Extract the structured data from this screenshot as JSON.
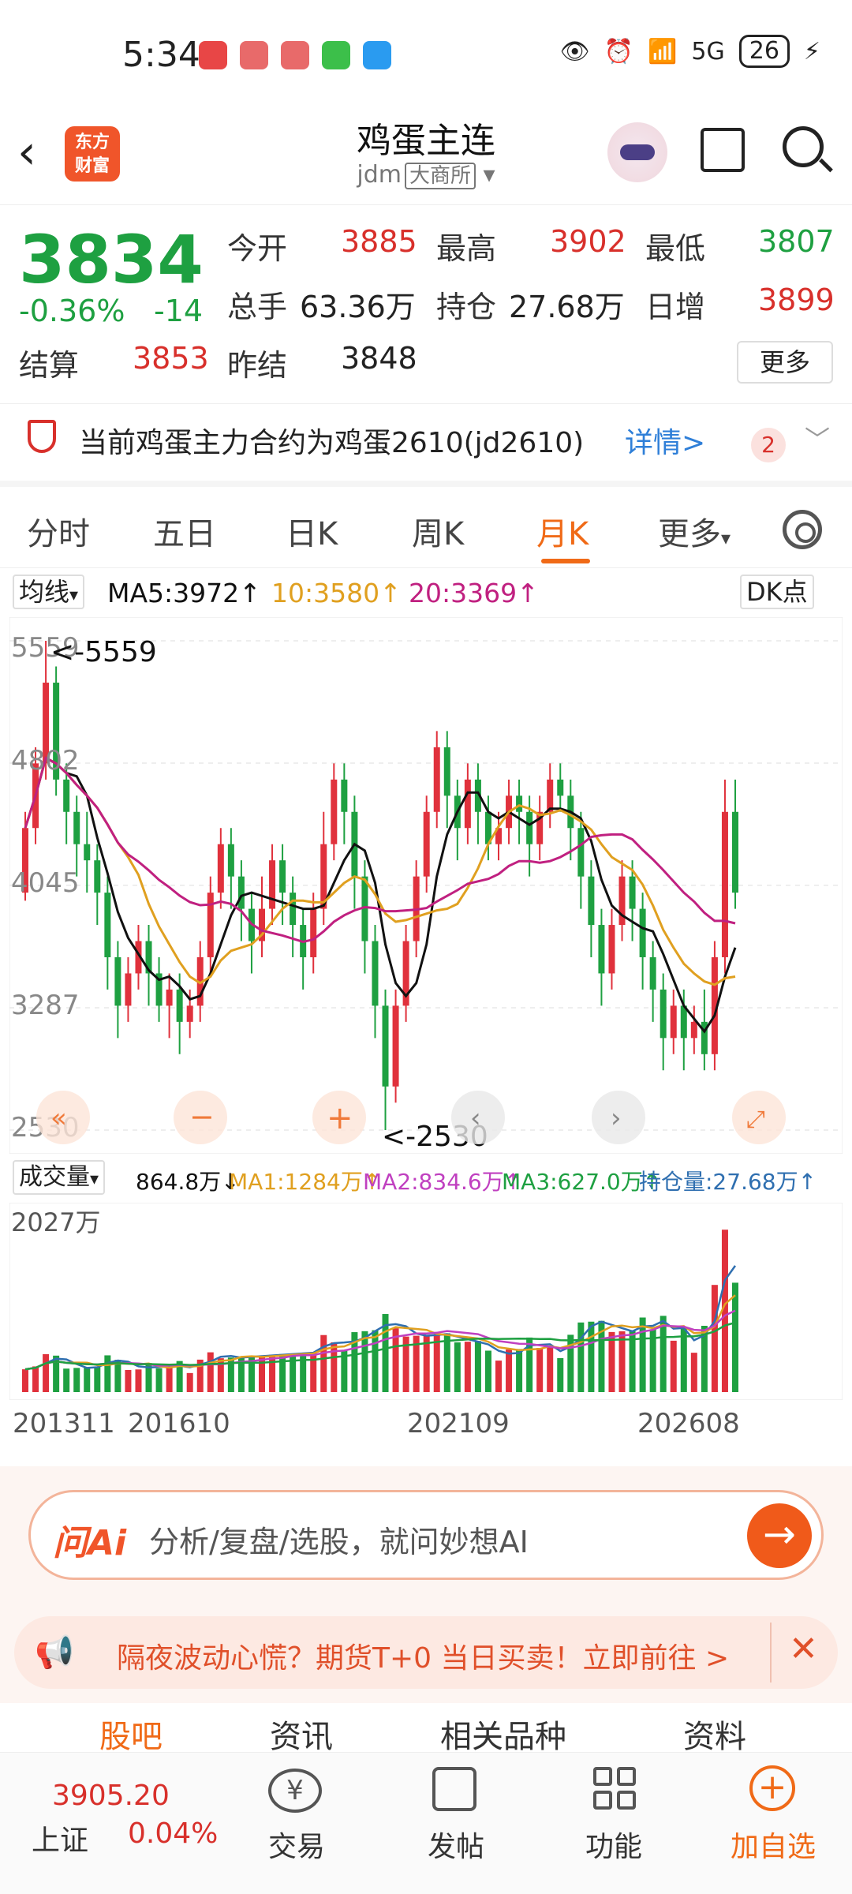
{
  "status_bar": {
    "time": "5:34",
    "battery": "26",
    "network": "5G"
  },
  "header": {
    "back": "‹",
    "logo_text": "东方\n财富",
    "title": "鸡蛋主连",
    "exchange_code": "jdm",
    "exchange_name": "大商所"
  },
  "quote": {
    "price": "3834",
    "change_pct": "-0.36%",
    "change": "-14",
    "open_label": "今开",
    "open": "3885",
    "high_label": "最高",
    "high": "3902",
    "low_label": "最低",
    "low": "3807",
    "vol_label": "总手",
    "vol": "63.36万",
    "oi_label": "持仓",
    "oi": "27.68万",
    "daily_label": "日增",
    "daily": "3899",
    "settle_label": "结算",
    "settle": "3853",
    "prev_label": "昨结",
    "prev": "3848",
    "more": "更多"
  },
  "notice": {
    "text": "当前鸡蛋主力合约为鸡蛋2610(jd2610)",
    "link": "详情>",
    "badge": "2"
  },
  "tabs": [
    "分时",
    "五日",
    "日K",
    "周K",
    "月K",
    "更多"
  ],
  "ma": {
    "select": "均线",
    "ma5": "MA5:3972",
    "ma10": "10:3580",
    "ma20": "20:3369",
    "dk": "DK点"
  },
  "chart_data": {
    "type": "candlestick",
    "y_ticks": [
      "5559",
      "4802",
      "4045",
      "3287",
      "2530"
    ],
    "max_marker": "<-5559",
    "min_marker": "<-2530",
    "colors": {
      "up": "#e0313c",
      "down": "#1ea041",
      "ma5": "#111111",
      "ma10": "#e0a020",
      "ma20": "#c02080"
    },
    "candles": [
      [
        4000,
        4400,
        3950,
        4500
      ],
      [
        4400,
        4800,
        4300,
        4900
      ],
      [
        4800,
        5300,
        4700,
        5559
      ],
      [
        5300,
        4700,
        4600,
        5400
      ],
      [
        4700,
        4500,
        4300,
        4800
      ],
      [
        4500,
        4300,
        4100,
        4600
      ],
      [
        4300,
        4200,
        4000,
        4500
      ],
      [
        4200,
        4000,
        3800,
        4300
      ],
      [
        4000,
        3600,
        3400,
        4100
      ],
      [
        3600,
        3300,
        3100,
        3700
      ],
      [
        3300,
        3500,
        3200,
        3600
      ],
      [
        3500,
        3700,
        3400,
        3800
      ],
      [
        3700,
        3500,
        3300,
        3800
      ],
      [
        3500,
        3300,
        3200,
        3600
      ],
      [
        3300,
        3400,
        3100,
        3500
      ],
      [
        3400,
        3200,
        3000,
        3500
      ],
      [
        3200,
        3300,
        3100,
        3400
      ],
      [
        3300,
        3600,
        3200,
        3700
      ],
      [
        3600,
        4000,
        3500,
        4100
      ],
      [
        4000,
        4300,
        3900,
        4400
      ],
      [
        4300,
        4100,
        3900,
        4400
      ],
      [
        4100,
        3900,
        3700,
        4200
      ],
      [
        3900,
        3700,
        3500,
        4000
      ],
      [
        3700,
        3900,
        3600,
        4100
      ],
      [
        3900,
        4200,
        3800,
        4300
      ],
      [
        4200,
        4000,
        3800,
        4300
      ],
      [
        4000,
        3800,
        3600,
        4100
      ],
      [
        3800,
        3600,
        3400,
        3900
      ],
      [
        3600,
        3900,
        3500,
        4000
      ],
      [
        3900,
        4300,
        3800,
        4500
      ],
      [
        4300,
        4700,
        4200,
        4800
      ],
      [
        4700,
        4500,
        4300,
        4800
      ],
      [
        4500,
        4100,
        3900,
        4600
      ],
      [
        4100,
        3700,
        3500,
        4200
      ],
      [
        3700,
        3300,
        3100,
        3800
      ],
      [
        3300,
        2800,
        2530,
        3400
      ],
      [
        2800,
        3300,
        2700,
        3400
      ],
      [
        3300,
        3700,
        3200,
        3800
      ],
      [
        3700,
        4100,
        3600,
        4200
      ],
      [
        4100,
        4500,
        4000,
        4600
      ],
      [
        4500,
        4900,
        4400,
        5000
      ],
      [
        4900,
        4600,
        4400,
        5000
      ],
      [
        4600,
        4400,
        4200,
        4700
      ],
      [
        4400,
        4700,
        4300,
        4800
      ],
      [
        4700,
        4500,
        4300,
        4800
      ],
      [
        4500,
        4300,
        4200,
        4600
      ],
      [
        4300,
        4400,
        4200,
        4500
      ],
      [
        4400,
        4600,
        4300,
        4700
      ],
      [
        4600,
        4500,
        4300,
        4700
      ],
      [
        4500,
        4300,
        4100,
        4600
      ],
      [
        4300,
        4500,
        4200,
        4600
      ],
      [
        4500,
        4700,
        4400,
        4800
      ],
      [
        4700,
        4600,
        4500,
        4800
      ],
      [
        4600,
        4400,
        4200,
        4700
      ],
      [
        4400,
        4100,
        3900,
        4500
      ],
      [
        4100,
        3800,
        3600,
        4200
      ],
      [
        3800,
        3500,
        3300,
        3900
      ],
      [
        3500,
        3800,
        3400,
        3900
      ],
      [
        3800,
        4100,
        3700,
        4200
      ],
      [
        4100,
        3900,
        3700,
        4200
      ],
      [
        3900,
        3600,
        3400,
        4000
      ],
      [
        3600,
        3400,
        3200,
        3700
      ],
      [
        3400,
        3100,
        2900,
        3500
      ],
      [
        3100,
        3300,
        3000,
        3400
      ],
      [
        3300,
        3100,
        2900,
        3400
      ],
      [
        3100,
        3200,
        3000,
        3300
      ],
      [
        3200,
        3000,
        2900,
        3400
      ],
      [
        3000,
        3600,
        2900,
        3700
      ],
      [
        3600,
        4500,
        3500,
        4700
      ],
      [
        4500,
        4000,
        3900,
        4700
      ]
    ]
  },
  "volume": {
    "select": "成交量",
    "value": "864.8万",
    "ma1": "MA1:1284万",
    "ma2": "MA2:834.6万",
    "ma3": "MA3:627.0万",
    "oi": "持仓量:27.68万",
    "y_tick": "2027万",
    "x_ticks": [
      "201311",
      "201610",
      "202109",
      "202608"
    ]
  },
  "ai_bar": {
    "brand": "问Ai",
    "placeholder": "分析/复盘/选股，就问妙想AI"
  },
  "promo": {
    "text": "隔夜波动心慌？期货T+0 当日买卖！立即前往 >"
  },
  "sub_tabs": [
    "股吧",
    "资讯",
    "相关品种",
    "资料"
  ],
  "bottom_nav": {
    "index_value": "3905.20",
    "index_name": "上证",
    "index_change": "0.04%",
    "trade": "交易",
    "post": "发帖",
    "func": "功能",
    "add": "加自选"
  }
}
